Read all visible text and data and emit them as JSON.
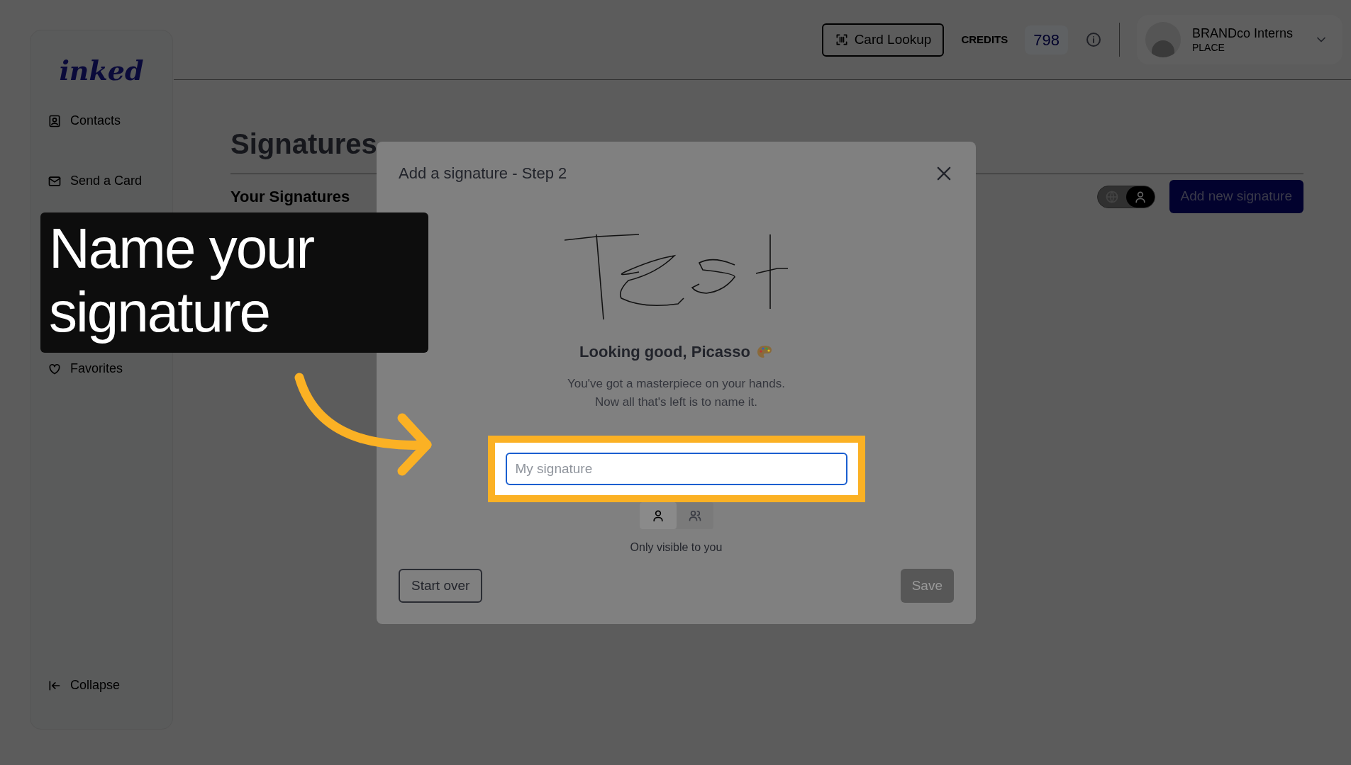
{
  "sidebar": {
    "logo": "inked",
    "items": [
      {
        "label": "Contacts"
      },
      {
        "label": "Send a Card"
      },
      {
        "label": "Favorites"
      }
    ],
    "collapse": "Collapse"
  },
  "topbar": {
    "card_lookup": "Card Lookup",
    "credits_label": "CREDITS",
    "credits": "798",
    "user": {
      "name": "BRANDco Interns",
      "org": "PLACE"
    }
  },
  "page": {
    "title": "Signatures",
    "section": "Your Signatures",
    "scope_toggle": [
      {
        "selected": false
      },
      {
        "selected": true
      }
    ],
    "add_button": "Add new signature"
  },
  "modal": {
    "title": "Add a signature - Step 2",
    "heading": "Looking good, Picasso",
    "message": [
      "You've got a masterpiece on your hands.",
      "Now all that's left is to name it."
    ],
    "name_field": {
      "placeholder": "My signature"
    },
    "visibility": [
      {
        "selected": true
      },
      {
        "selected": false
      }
    ],
    "caption": "Only visible to you",
    "start_over": "Start over",
    "save": {
      "label": "Save",
      "disabled": true
    }
  },
  "callout": {
    "text": "Name your signature"
  }
}
